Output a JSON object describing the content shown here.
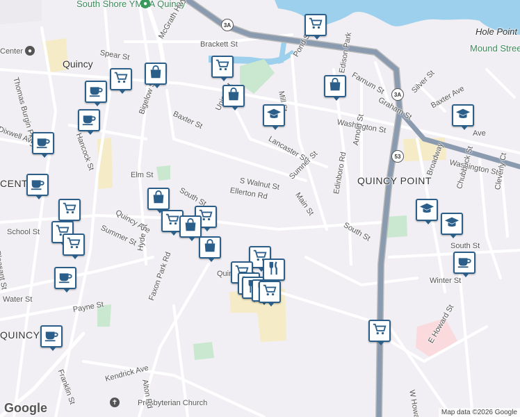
{
  "map": {
    "street_labels": [
      {
        "text": "Quincy",
        "cls": "city"
      },
      {
        "text": "QUINCY POINT",
        "cls": "big"
      },
      {
        "text": "CENTER",
        "cls": "big"
      },
      {
        "text": "QUINCY",
        "cls": "big"
      },
      {
        "text": "Hole Point",
        "cls": "place"
      },
      {
        "text": "Mound Street Beach",
        "cls": "green"
      },
      {
        "text": "South Shore YMCA Quincy",
        "cls": "green"
      },
      {
        "text": "Presbyterian Church",
        "cls": ""
      },
      {
        "text": "McGrath Hwy",
        "cls": ""
      },
      {
        "text": "Brackett St",
        "cls": ""
      },
      {
        "text": "Spear St",
        "cls": ""
      },
      {
        "text": "Pond St",
        "cls": ""
      },
      {
        "text": "Mill St",
        "cls": ""
      },
      {
        "text": "Edison Park",
        "cls": ""
      },
      {
        "text": "Farnum St",
        "cls": ""
      },
      {
        "text": "Graham St",
        "cls": ""
      },
      {
        "text": "Silver St",
        "cls": ""
      },
      {
        "text": "Baxter Ave",
        "cls": ""
      },
      {
        "text": "Washington St",
        "cls": ""
      },
      {
        "text": "Washington St",
        "cls": ""
      },
      {
        "text": "Baxter St",
        "cls": ""
      },
      {
        "text": "Bigelow St",
        "cls": ""
      },
      {
        "text": "Union St",
        "cls": ""
      },
      {
        "text": "Lancaster St",
        "cls": ""
      },
      {
        "text": "S Walnut St",
        "cls": ""
      },
      {
        "text": "Sumner St",
        "cls": ""
      },
      {
        "text": "Ellerton Rd",
        "cls": ""
      },
      {
        "text": "Main St",
        "cls": ""
      },
      {
        "text": "Edinboro Rd",
        "cls": ""
      },
      {
        "text": "Arnold St",
        "cls": ""
      },
      {
        "text": "Broadway",
        "cls": ""
      },
      {
        "text": "Chubbuck St",
        "cls": ""
      },
      {
        "text": "Cleverly Ct",
        "cls": ""
      },
      {
        "text": "South St",
        "cls": ""
      },
      {
        "text": "South St",
        "cls": ""
      },
      {
        "text": "Elm St",
        "cls": ""
      },
      {
        "text": "South St",
        "cls": ""
      },
      {
        "text": "Quincy Ave",
        "cls": ""
      },
      {
        "text": "Summer St",
        "cls": ""
      },
      {
        "text": "Hyde St",
        "cls": ""
      },
      {
        "text": "Faxon Park Rd",
        "cls": ""
      },
      {
        "text": "Kendrick Ave",
        "cls": ""
      },
      {
        "text": "Alton Rd",
        "cls": ""
      },
      {
        "text": "Franklin St",
        "cls": ""
      },
      {
        "text": "Payne St",
        "cls": ""
      },
      {
        "text": "Water St",
        "cls": ""
      },
      {
        "text": "Pleasant St",
        "cls": ""
      },
      {
        "text": "School St",
        "cls": ""
      },
      {
        "text": "Thomas Burgin Pkwy",
        "cls": ""
      },
      {
        "text": "Dixwell Ave",
        "cls": ""
      },
      {
        "text": "Hancock St",
        "cls": ""
      },
      {
        "text": "Winter St",
        "cls": ""
      },
      {
        "text": "E Howard St",
        "cls": ""
      },
      {
        "text": "W Howard St",
        "cls": ""
      },
      {
        "text": "Center",
        "cls": ""
      },
      {
        "text": "Ave",
        "cls": ""
      },
      {
        "text": "Quincy Ave",
        "cls": ""
      }
    ],
    "route_shields": [
      "3A",
      "3A",
      "53"
    ],
    "pins": [
      {
        "icon": "shopping-cart-icon"
      },
      {
        "icon": "shopping-cart-icon"
      },
      {
        "icon": "shopping-bag-icon"
      },
      {
        "icon": "shopping-cart-icon"
      },
      {
        "icon": "shopping-bag-icon"
      },
      {
        "icon": "coffee-cup-icon"
      },
      {
        "icon": "shopping-bag-icon"
      },
      {
        "icon": "school-icon"
      },
      {
        "icon": "coffee-cup-icon"
      },
      {
        "icon": "coffee-cup-icon"
      },
      {
        "icon": "school-icon"
      },
      {
        "icon": "coffee-cup-icon"
      },
      {
        "icon": "shopping-cart-icon"
      },
      {
        "icon": "shopping-cart-icon"
      },
      {
        "icon": "shopping-cart-icon"
      },
      {
        "icon": "shopping-bag-icon"
      },
      {
        "icon": "shopping-cart-icon"
      },
      {
        "icon": "shopping-cart-icon"
      },
      {
        "icon": "shopping-bag-icon"
      },
      {
        "icon": "shopping-bag-icon"
      },
      {
        "icon": "shopping-cart-icon"
      },
      {
        "icon": "shopping-cart-icon"
      },
      {
        "icon": "coffee-cup-icon"
      },
      {
        "icon": "school-icon"
      },
      {
        "icon": "school-icon"
      },
      {
        "icon": "coffee-cup-icon"
      },
      {
        "icon": "shopping-cart-icon"
      },
      {
        "icon": "fork-knife-icon"
      },
      {
        "icon": "shopping-cart-icon"
      },
      {
        "icon": "fork-knife-icon"
      },
      {
        "icon": "fork-knife-icon"
      },
      {
        "icon": "shopping-cart-icon"
      },
      {
        "icon": "coffee-cup-icon"
      }
    ],
    "logo": "Google",
    "attribution": "Map data ©2026 Google"
  }
}
